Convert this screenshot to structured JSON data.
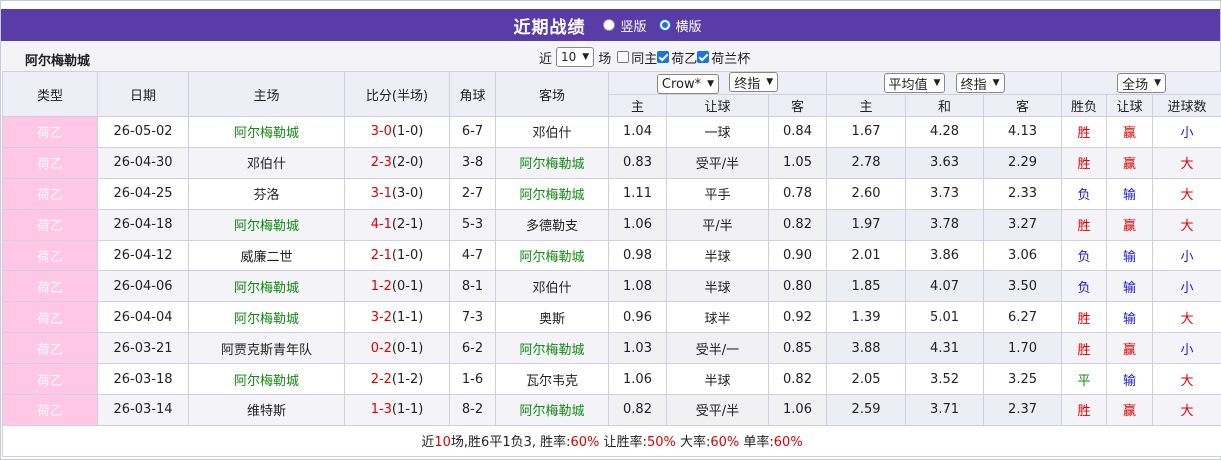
{
  "title": "近期战绩",
  "view_options": [
    {
      "label": "竖版",
      "selected": false
    },
    {
      "label": "横版",
      "selected": true
    }
  ],
  "team": "阿尔梅勒城",
  "filter": {
    "prefix": "近",
    "count": "10",
    "suffix": "场",
    "checkboxes": [
      {
        "label": "同主",
        "checked": false
      },
      {
        "label": "荷乙",
        "checked": true
      },
      {
        "label": "荷兰杯",
        "checked": true
      }
    ]
  },
  "header": {
    "type": "类型",
    "date": "日期",
    "home": "主场",
    "score": "比分(半场)",
    "corners": "角球",
    "away": "客场",
    "company": "Crow*",
    "handicap_mode": "终指",
    "euro_mode": "平均值",
    "euro_mode2": "终指",
    "scope": "全场",
    "sub": [
      "主",
      "让球",
      "客",
      "主",
      "和",
      "客",
      "胜负",
      "让球",
      "进球数"
    ]
  },
  "rows": [
    {
      "type": "荷乙",
      "date": "26-05-02",
      "home": "阿尔梅勒城",
      "score": "3-0",
      "half": "(1-0)",
      "corners": "6-7",
      "away": "邓伯什",
      "o_home": "1.04",
      "hcp": "一球",
      "o_away": "0.84",
      "e_home": "1.67",
      "e_draw": "4.28",
      "e_away": "4.13",
      "wl": "胜",
      "hr": "赢",
      "goals": "小"
    },
    {
      "type": "荷乙",
      "date": "26-04-30",
      "home": "邓伯什",
      "score": "2-3",
      "half": "(2-0)",
      "corners": "3-8",
      "away": "阿尔梅勒城",
      "o_home": "0.83",
      "hcp": "受平/半",
      "o_away": "1.05",
      "e_home": "2.78",
      "e_draw": "3.63",
      "e_away": "2.29",
      "wl": "胜",
      "hr": "赢",
      "goals": "大"
    },
    {
      "type": "荷乙",
      "date": "26-04-25",
      "home": "芬洛",
      "score": "3-1",
      "half": "(3-0)",
      "corners": "2-7",
      "away": "阿尔梅勒城",
      "o_home": "1.11",
      "hcp": "平手",
      "o_away": "0.78",
      "e_home": "2.60",
      "e_draw": "3.73",
      "e_away": "2.33",
      "wl": "负",
      "hr": "输",
      "goals": "大"
    },
    {
      "type": "荷乙",
      "date": "26-04-18",
      "home": "阿尔梅勒城",
      "score": "4-1",
      "half": "(2-1)",
      "corners": "5-3",
      "away": "多德勒支",
      "o_home": "1.06",
      "hcp": "平/半",
      "o_away": "0.82",
      "e_home": "1.97",
      "e_draw": "3.78",
      "e_away": "3.27",
      "wl": "胜",
      "hr": "赢",
      "goals": "大"
    },
    {
      "type": "荷乙",
      "date": "26-04-12",
      "home": "威廉二世",
      "score": "2-1",
      "half": "(1-0)",
      "corners": "4-7",
      "away": "阿尔梅勒城",
      "o_home": "0.98",
      "hcp": "半球",
      "o_away": "0.90",
      "e_home": "2.01",
      "e_draw": "3.86",
      "e_away": "3.06",
      "wl": "负",
      "hr": "输",
      "goals": "小"
    },
    {
      "type": "荷乙",
      "date": "26-04-06",
      "home": "阿尔梅勒城",
      "score": "1-2",
      "half": "(0-1)",
      "corners": "8-1",
      "away": "邓伯什",
      "o_home": "1.08",
      "hcp": "半球",
      "o_away": "0.80",
      "e_home": "1.85",
      "e_draw": "4.07",
      "e_away": "3.50",
      "wl": "负",
      "hr": "输",
      "goals": "小"
    },
    {
      "type": "荷乙",
      "date": "26-04-04",
      "home": "阿尔梅勒城",
      "score": "3-2",
      "half": "(1-1)",
      "corners": "7-3",
      "away": "奥斯",
      "o_home": "0.96",
      "hcp": "球半",
      "o_away": "0.92",
      "e_home": "1.39",
      "e_draw": "5.01",
      "e_away": "6.27",
      "wl": "胜",
      "hr": "输",
      "goals": "大"
    },
    {
      "type": "荷乙",
      "date": "26-03-21",
      "home": "阿贾克斯青年队",
      "score": "0-2",
      "half": "(0-1)",
      "corners": "6-2",
      "away": "阿尔梅勒城",
      "o_home": "1.03",
      "hcp": "受半/一",
      "o_away": "0.85",
      "e_home": "3.88",
      "e_draw": "4.31",
      "e_away": "1.70",
      "wl": "胜",
      "hr": "赢",
      "goals": "小"
    },
    {
      "type": "荷乙",
      "date": "26-03-18",
      "home": "阿尔梅勒城",
      "score": "2-2",
      "half": "(1-2)",
      "corners": "1-6",
      "away": "瓦尔韦克",
      "o_home": "1.06",
      "hcp": "半球",
      "o_away": "0.82",
      "e_home": "2.05",
      "e_draw": "3.52",
      "e_away": "3.25",
      "wl": "平",
      "hr": "输",
      "goals": "大"
    },
    {
      "type": "荷乙",
      "date": "26-03-14",
      "home": "维特斯",
      "score": "1-3",
      "half": "(1-1)",
      "corners": "8-2",
      "away": "阿尔梅勒城",
      "o_home": "0.82",
      "hcp": "受平/半",
      "o_away": "1.06",
      "e_home": "2.59",
      "e_draw": "3.71",
      "e_away": "2.37",
      "wl": "胜",
      "hr": "赢",
      "goals": "大"
    }
  ],
  "summary": {
    "prefix": "近",
    "games": "10",
    "record": "场,胜6平1负3, 胜率:",
    "win_rate": "60%",
    "hcp_label": " 让胜率:",
    "hcp_rate": "50%",
    "big_label": " 大率:",
    "big_rate": "60%",
    "odd_label": " 单率:",
    "odd_rate": "60%"
  },
  "colors": {
    "title_bar": "#5a3ca8",
    "team_highlight": "#118a11",
    "win": "#e00000",
    "lose": "#1a1ad8",
    "draw": "#118a11",
    "type_badge": "#ffc6e6"
  }
}
